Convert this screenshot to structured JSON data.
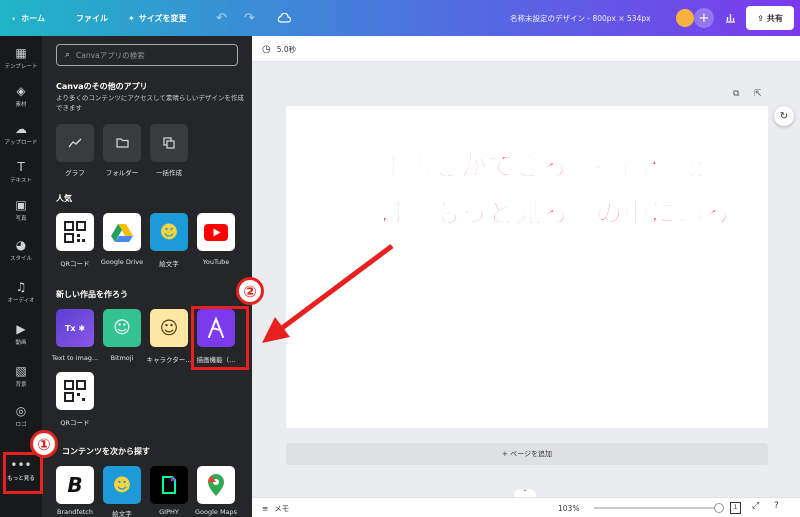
{
  "topbar": {
    "home": "ホーム",
    "file": "ファイル",
    "resize": "サイズを変更",
    "title": "名称未設定のデザイン - 800px × 534px",
    "share": "共有"
  },
  "rail": {
    "items": [
      {
        "label": "テンプレート",
        "icon": "template-icon"
      },
      {
        "label": "素材",
        "icon": "elements-icon"
      },
      {
        "label": "アップロード",
        "icon": "upload-icon"
      },
      {
        "label": "テキスト",
        "icon": "text-icon"
      },
      {
        "label": "写真",
        "icon": "photo-icon"
      },
      {
        "label": "スタイル",
        "icon": "palette-icon"
      },
      {
        "label": "オーディオ",
        "icon": "music-icon"
      },
      {
        "label": "動画",
        "icon": "video-icon"
      },
      {
        "label": "背景",
        "icon": "background-icon"
      },
      {
        "label": "ロゴ",
        "icon": "logo-icon"
      },
      {
        "label": "もっと見る",
        "icon": "more-icon"
      }
    ]
  },
  "panel": {
    "search_placeholder": "Canvaアプリの検索",
    "other_apps_title": "Canvaのその他のアプリ",
    "other_apps_desc": "より多くのコンテンツにアクセスして素晴らしいデザインを作成できます",
    "tools": [
      {
        "label": "グラフ",
        "icon": "chart-icon"
      },
      {
        "label": "フォルダー",
        "icon": "folder-icon"
      },
      {
        "label": "一括作成",
        "icon": "bulk-create-icon"
      }
    ],
    "popular_title": "人気",
    "popular": [
      {
        "label": "QRコード",
        "icon": "qr-code-icon"
      },
      {
        "label": "Google Drive",
        "icon": "google-drive-icon"
      },
      {
        "label": "絵文字",
        "icon": "emoji-icon"
      },
      {
        "label": "YouTube",
        "icon": "youtube-icon"
      }
    ],
    "create_title": "新しい作品を作ろう",
    "create": [
      {
        "label": "Text to imag...",
        "icon": "text-to-image-icon"
      },
      {
        "label": "Bitmoji",
        "icon": "bitmoji-icon"
      },
      {
        "label": "キャラクター...",
        "icon": "character-icon"
      },
      {
        "label": "描画機能（...",
        "icon": "draw-icon"
      },
      {
        "label": "QRコード",
        "icon": "qr-code-icon"
      }
    ],
    "explore_title": "コンテンツを次から探す",
    "explore": [
      {
        "label": "Brandfetch",
        "icon": "brandfetch-icon"
      },
      {
        "label": "絵文字",
        "icon": "emoji-icon"
      },
      {
        "label": "GIPHY",
        "icon": "giphy-icon"
      },
      {
        "label": "Google Maps",
        "icon": "google-maps-icon"
      }
    ]
  },
  "canvas": {
    "duration": "5.0秒",
    "add_page": "+ ページを追加"
  },
  "bottombar": {
    "notes": "メモ",
    "zoom": "103%",
    "page_number": "1"
  },
  "annotation": {
    "line1": "手書きができる『描画機能』",
    "line2": "は『もっと見る』の中にある",
    "marker1": "①",
    "marker2": "②",
    "color": "#e8211f"
  },
  "colors": {
    "topbar_start": "#1fb5c6",
    "topbar_end": "#7c3aed",
    "panel_bg": "#252627",
    "rail_bg": "#18191b"
  }
}
